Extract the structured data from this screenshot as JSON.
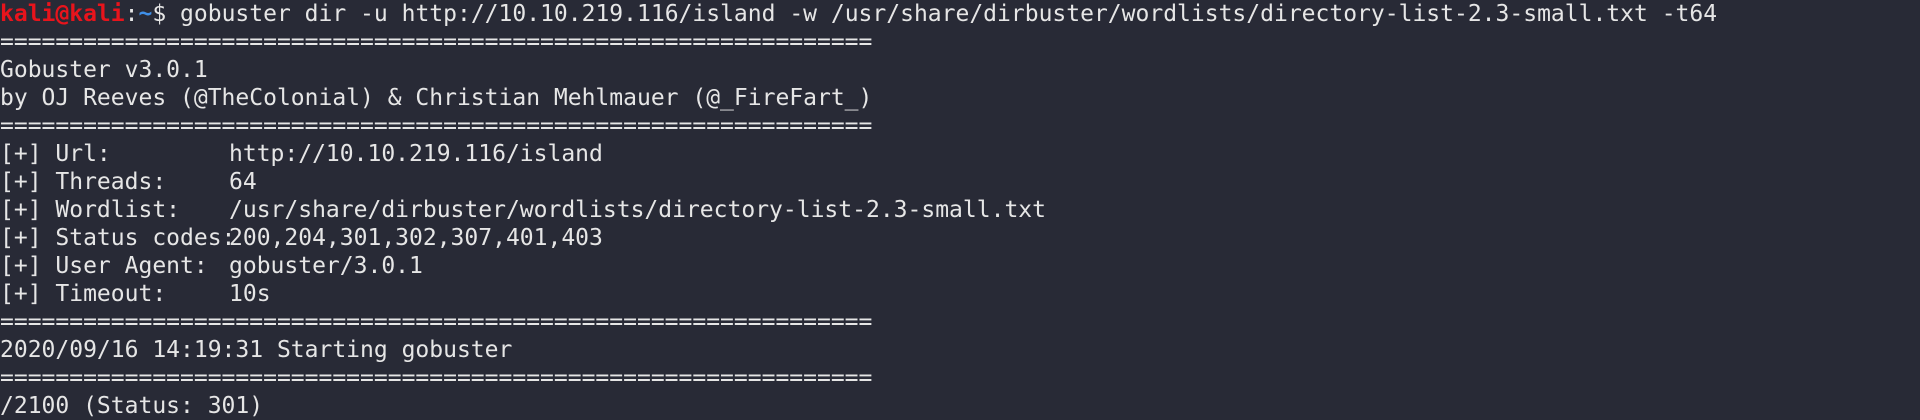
{
  "prompt": {
    "user_host": "kali@kali",
    "colon": ":",
    "cwd": "~",
    "symbol": "$ ",
    "command": "gobuster dir -u http://10.10.219.116/island -w /usr/share/dirbuster/wordlists/directory-list-2.3-small.txt -t64"
  },
  "separator": "===============================================================",
  "banner": {
    "title": "Gobuster v3.0.1",
    "authors": "by OJ Reeves (@TheColonial) & Christian Mehlmauer (@_FireFart_)"
  },
  "config": [
    {
      "label": "[+] Url:",
      "value": "http://10.10.219.116/island"
    },
    {
      "label": "[+] Threads:",
      "value": "64"
    },
    {
      "label": "[+] Wordlist:",
      "value": "/usr/share/dirbuster/wordlists/directory-list-2.3-small.txt"
    },
    {
      "label": "[+] Status codes:",
      "value": "200,204,301,302,307,401,403"
    },
    {
      "label": "[+] User Agent:",
      "value": "gobuster/3.0.1"
    },
    {
      "label": "[+] Timeout:",
      "value": "10s"
    }
  ],
  "start_line": "2020/09/16 14:19:31 Starting gobuster",
  "results": [
    "/2100 (Status: 301)"
  ],
  "colors": {
    "background": "#282a36",
    "user": "#e8141c",
    "path": "#3f8fe8",
    "text": "#e6e6e6"
  }
}
